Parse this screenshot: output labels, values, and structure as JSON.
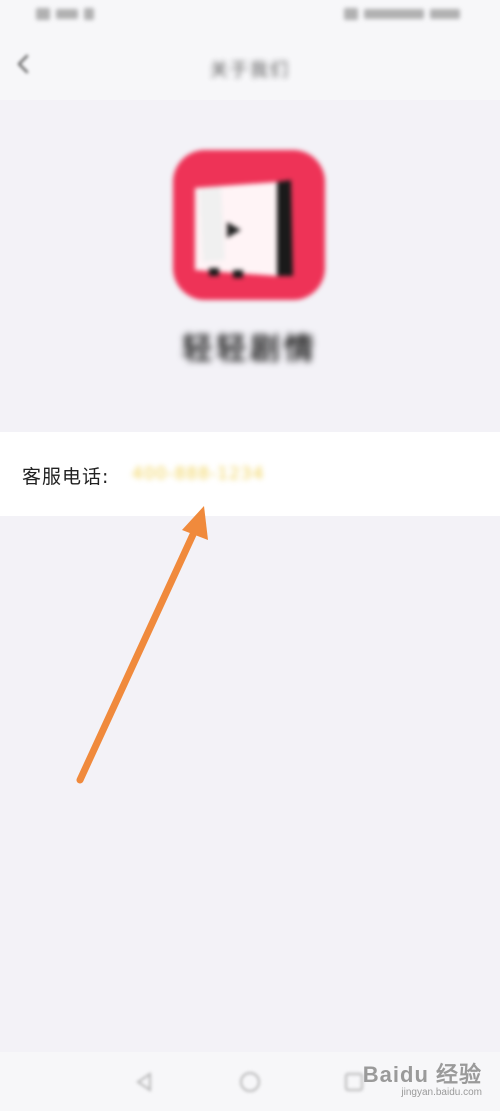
{
  "header": {
    "title": "关于我们"
  },
  "app": {
    "name": "轻轻剧情"
  },
  "contact": {
    "label": "客服电话:",
    "value": "400-888-1234"
  },
  "watermark": {
    "brand": "Baidu 经验",
    "url": "jingyan.baidu.com"
  },
  "colors": {
    "app_icon": "#ee3357",
    "highlight": "#f0d25a",
    "arrow": "#f08a3c",
    "background": "#f3f2f7"
  }
}
